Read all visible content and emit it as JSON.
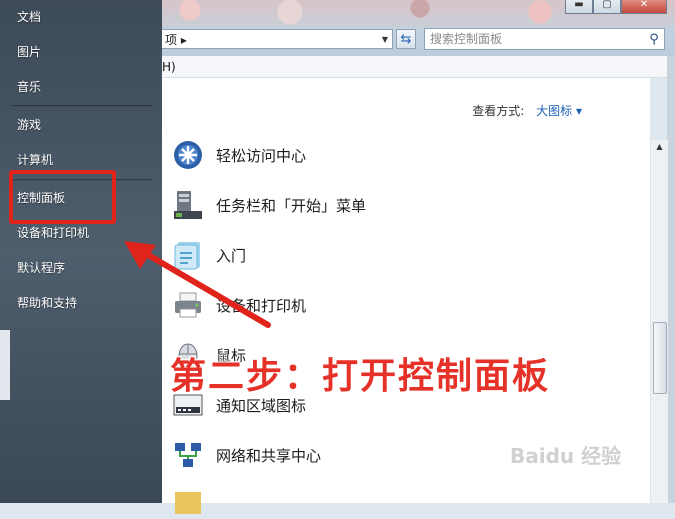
{
  "start_menu": {
    "items": [
      {
        "label": "文档"
      },
      {
        "label": "图片"
      },
      {
        "label": "音乐"
      },
      {
        "label": "游戏"
      },
      {
        "label": "计算机"
      },
      {
        "label": "控制面板"
      },
      {
        "label": "设备和打印机"
      },
      {
        "label": "默认程序"
      },
      {
        "label": "帮助和支持"
      }
    ]
  },
  "address_bar": {
    "text": "项 ▸"
  },
  "search": {
    "placeholder": "搜索控制面板"
  },
  "menubar": {
    "text": "H)"
  },
  "view": {
    "label": "查看方式:",
    "value": "大图标 ▾"
  },
  "control_panel_items": [
    {
      "label": "轻松访问中心",
      "icon": "ease-of-access-icon"
    },
    {
      "label": "任务栏和「开始」菜单",
      "icon": "taskbar-icon"
    },
    {
      "label": "入门",
      "icon": "getting-started-icon"
    },
    {
      "label": "设备和打印机",
      "icon": "printer-icon"
    },
    {
      "label": "鼠标",
      "icon": "mouse-icon"
    },
    {
      "label": "通知区域图标",
      "icon": "notification-area-icon"
    },
    {
      "label": "网络和共享中心",
      "icon": "network-icon"
    }
  ],
  "annotation": {
    "text": "第二步：打开控制面板"
  },
  "watermark": {
    "text": "Baidu 经验"
  },
  "colors": {
    "highlight": "#e0241b",
    "annotation": "#e53128",
    "link": "#1b5fb5"
  }
}
